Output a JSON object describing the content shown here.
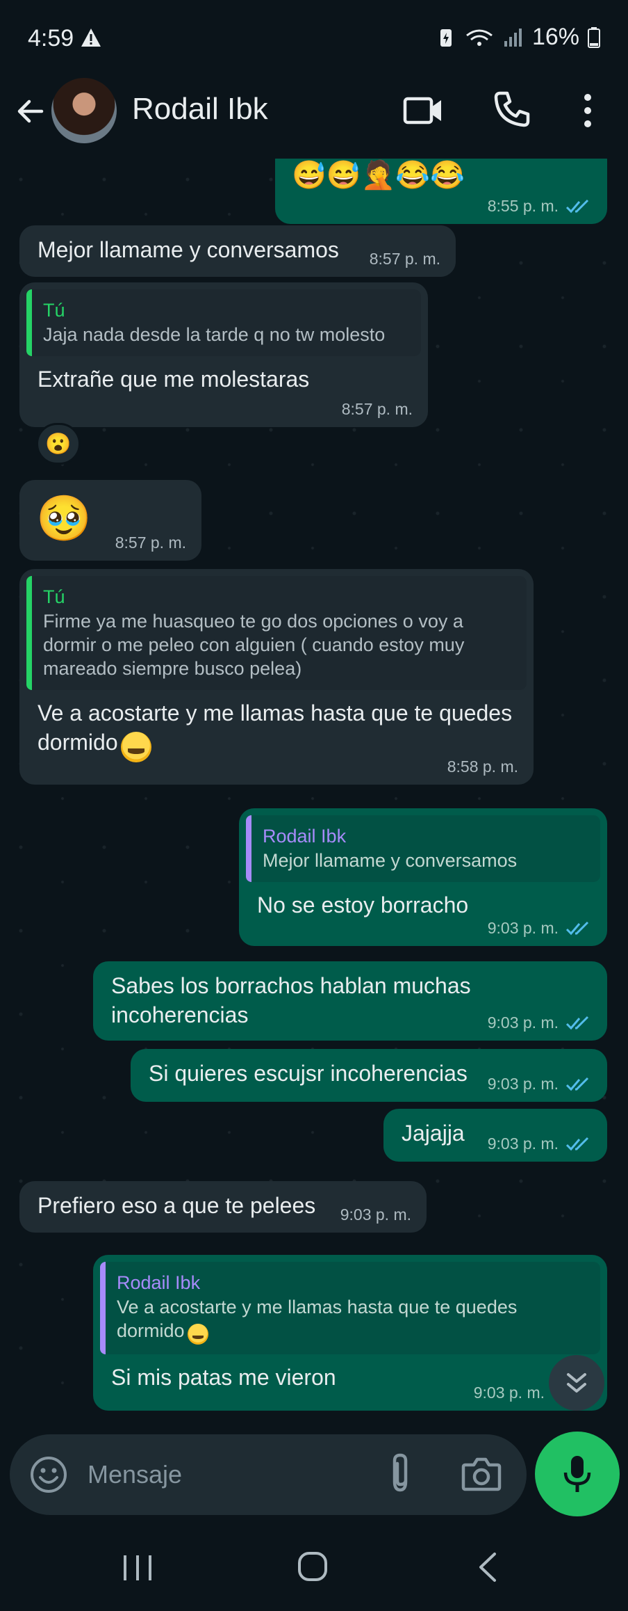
{
  "status": {
    "time": "4:59",
    "battery": "16%"
  },
  "header": {
    "contact_name": "Rodail Ibk"
  },
  "messages": {
    "m0": {
      "emojis": "😅😅🤦😂😂",
      "time": "8:55 p. m."
    },
    "m1": {
      "text": "Mejor llamame y conversamos",
      "time": "8:57 p. m."
    },
    "m2": {
      "quote_author": "Tú",
      "quote_text": "Jaja nada desde la tarde q no tw molesto",
      "text": "Extrañe que me molestaras",
      "time": "8:57 p. m.",
      "reaction": "😮"
    },
    "m3": {
      "emoji": "🥹",
      "time": "8:57 p. m."
    },
    "m4": {
      "quote_author": "Tú",
      "quote_text": "Firme ya me huasqueo te go dos opciones o voy a dormir o me peleo con alguien ( cuando estoy muy mareado siempre busco pelea)",
      "text": "Ve a acostarte y me llamas hasta que te quedes dormido",
      "time": "8:58 p. m."
    },
    "m5": {
      "quote_author": "Rodail Ibk",
      "quote_text": "Mejor llamame y conversamos",
      "text": "No se estoy borracho",
      "time": "9:03 p. m."
    },
    "m6": {
      "text": "Sabes los borrachos hablan muchas incoherencias",
      "time": "9:03 p. m."
    },
    "m7": {
      "text": "Si quieres escujsr incoherencias",
      "time": "9:03 p. m."
    },
    "m8": {
      "text": "Jajajja",
      "time": "9:03 p. m."
    },
    "m9": {
      "text": "Prefiero eso a que te pelees",
      "time": "9:03 p. m."
    },
    "m10": {
      "quote_author": "Rodail Ibk",
      "quote_text": "Ve a acostarte y me llamas hasta que te quedes dormido",
      "text": "Si mis patas me vieron",
      "time": "9:03 p. m."
    }
  },
  "input": {
    "placeholder": "Mensaje"
  },
  "colors": {
    "incoming": "#202c33",
    "outgoing": "#005c4b",
    "accent_green": "#21c063",
    "quote_you": "#25d366",
    "quote_contact": "#a78bfa",
    "read_ticks": "#53bdeb"
  }
}
